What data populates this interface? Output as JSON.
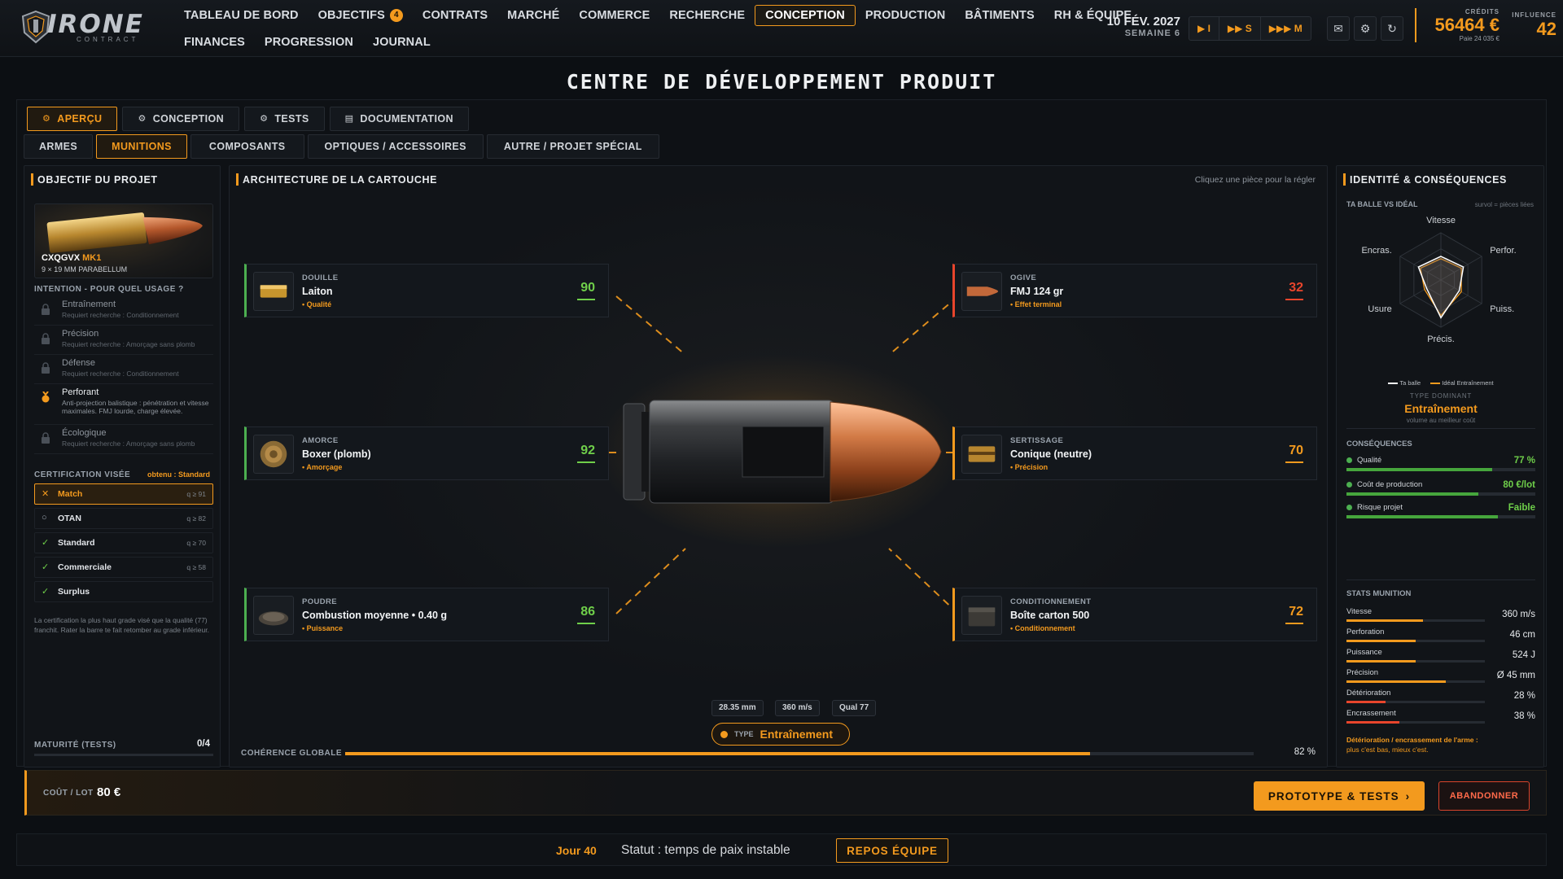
{
  "app": {
    "logo_text": "IRONE",
    "logo_sub": "CONTRACT"
  },
  "nav": {
    "row1": [
      "TABLEAU DE BORD",
      "OBJECTIFS",
      "CONTRATS",
      "MARCHÉ",
      "COMMERCE",
      "RECHERCHE",
      "CONCEPTION",
      "PRODUCTION",
      "BÂTIMENTS",
      "RH & ÉQUIPE"
    ],
    "row2": [
      "FINANCES",
      "PROGRESSION",
      "JOURNAL"
    ],
    "objectifs_badge": "4",
    "active": "CONCEPTION"
  },
  "header": {
    "date": "10 FÉV. 2027",
    "week": "SEMAINE 6",
    "speeds": [
      "▶ I",
      "▶▶ S",
      "▶▶▶ M"
    ],
    "credits_label": "CRÉDITS",
    "credits_value": "56464 €",
    "credits_sub": "Paie 24 035 €",
    "influence_label": "INFLUENCE",
    "influence_value": "42"
  },
  "page": {
    "title": "CENTRE DE DÉVELOPPEMENT PRODUIT",
    "main_tabs": [
      {
        "label": "APERÇU",
        "icon": "gear-icon"
      },
      {
        "label": "CONCEPTION",
        "icon": "gear-icon"
      },
      {
        "label": "TESTS",
        "icon": "gear-icon"
      },
      {
        "label": "DOCUMENTATION",
        "icon": "doc-icon"
      }
    ],
    "category_tabs": [
      "ARMES",
      "MUNITIONS",
      "COMPOSANTS",
      "OPTIQUES / ACCESSOIRES",
      "AUTRE / PROJET SPÉCIAL"
    ]
  },
  "left": {
    "title": "OBJECTIF DU PROJET",
    "product_name": "CXQGVX",
    "product_mk": "MK1",
    "product_caliber": "9 × 19 MM PARABELLUM",
    "intent_label": "INTENTION - POUR QUEL USAGE ?",
    "intents": [
      {
        "name": "Entraînement",
        "req": "Requiert recherche : Conditionnement"
      },
      {
        "name": "Précision",
        "req": "Requiert recherche : Amorçage sans plomb"
      },
      {
        "name": "Défense",
        "req": "Requiert recherche : Conditionnement"
      },
      {
        "name": "Perforant",
        "req": "Anti-projection balistique : pénétration et vitesse maximales. FMJ lourde, charge élevée."
      },
      {
        "name": "Écologique",
        "req": "Requiert recherche : Amorçage sans plomb"
      }
    ],
    "cert_label": "CERTIFICATION VISÉE",
    "cert_obtained": "obtenu : Standard",
    "certs": [
      {
        "name": "Match",
        "q": "q ≥ 91",
        "mark": "✕"
      },
      {
        "name": "OTAN",
        "q": "q ≥ 82",
        "mark": "○"
      },
      {
        "name": "Standard",
        "q": "q ≥ 70",
        "mark": "✓"
      },
      {
        "name": "Commerciale",
        "q": "q ≥ 58",
        "mark": "✓"
      },
      {
        "name": "Surplus",
        "q": "",
        "mark": "✓"
      }
    ],
    "cert_note": "La certification la plus haut grade visé que la qualité (77) franchit. Rater la barre te fait retomber au grade inférieur.",
    "maturity_label": "MATURITÉ (TESTS)",
    "maturity_value": "0/4"
  },
  "center": {
    "title": "ARCHITECTURE DE LA CARTOUCHE",
    "hint": "Cliquez une pièce pour la régler",
    "nodes": [
      {
        "cat": "DOUILLE",
        "value": "Laiton",
        "tag": "• Qualité",
        "score": "90",
        "color": "#6fcf4a"
      },
      {
        "cat": "OGIVE",
        "value": "FMJ 124 gr",
        "tag": "• Effet terminal",
        "score": "32",
        "color": "#e8452c"
      },
      {
        "cat": "AMORCE",
        "value": "Boxer (plomb)",
        "tag": "• Amorçage",
        "score": "92",
        "color": "#6fcf4a"
      },
      {
        "cat": "SERTISSAGE",
        "value": "Conique (neutre)",
        "tag": "• Précision",
        "score": "70",
        "color": "#f39a1e"
      },
      {
        "cat": "POUDRE",
        "value": "Combustion moyenne • 0.40 g",
        "tag": "• Puissance",
        "score": "86",
        "color": "#6fcf4a"
      },
      {
        "cat": "CONDITIONNEMENT",
        "value": "Boîte carton 500",
        "tag": "• Conditionnement",
        "score": "72",
        "color": "#f39a1e"
      }
    ],
    "chips": [
      "28.35 mm",
      "360 m/s",
      "Qual 77"
    ],
    "type_label": "TYPE",
    "type_value": "Entraînement",
    "coherence_label": "COHÉRENCE GLOBALE",
    "coherence_value": "82 %",
    "coherence_fraction": 0.82
  },
  "right": {
    "title": "IDENTITÉ & CONSÉQUENCES",
    "radar_label": "TA BALLE VS IDÉAL",
    "radar_hint": "survol = pièces liées",
    "radar_axes": [
      "Vitesse",
      "Perfor.",
      "Puiss.",
      "Précis.",
      "Usure",
      "Encras."
    ],
    "radar_ball": [
      0.5,
      0.55,
      0.45,
      0.8,
      0.35,
      0.55
    ],
    "radar_ideal": [
      0.45,
      0.5,
      0.5,
      0.75,
      0.4,
      0.5
    ],
    "legend_ball": "Ta balle",
    "legend_ideal": "Idéal Entraînement",
    "dominant_label": "TYPE DOMINANT",
    "dominant_value": "Entraînement",
    "dominant_sub": "volume au meilleur coût",
    "cons_label": "CONSÉQUENCES",
    "consequences": [
      {
        "name": "Qualité",
        "value": "77 %",
        "fraction": 0.77
      },
      {
        "name": "Coût de production",
        "value": "80 €/lot",
        "fraction": 0.7
      },
      {
        "name": "Risque projet",
        "value": "Faible",
        "fraction": 0.8
      }
    ],
    "stats_label": "STATS MUNITION",
    "stats": [
      {
        "name": "Vitesse",
        "value": "360 m/s",
        "fraction": 0.55,
        "color": "#f39a1e"
      },
      {
        "name": "Perforation",
        "value": "46 cm",
        "fraction": 0.5,
        "color": "#f39a1e"
      },
      {
        "name": "Puissance",
        "value": "524 J",
        "fraction": 0.5,
        "color": "#f39a1e"
      },
      {
        "name": "Précision",
        "value": "Ø 45 mm",
        "fraction": 0.72,
        "color": "#f39a1e"
      },
      {
        "name": "Détérioration",
        "value": "28 %",
        "fraction": 0.28,
        "color": "#e8452c"
      },
      {
        "name": "Encrassement",
        "value": "38 %",
        "fraction": 0.38,
        "color": "#e8452c"
      }
    ],
    "note_title": "Détérioration / encrassement de l'arme :",
    "note_sub": "plus c'est bas, mieux c'est."
  },
  "footer": {
    "cost_label": "COÛT / LOT",
    "cost_value": "80 €",
    "primary_btn": "PROTOTYPE & TESTS",
    "danger_btn": "ABANDONNER",
    "day": "Jour 40",
    "status": "Statut : temps de paix instable",
    "rest_btn": "REPOS ÉQUIPE"
  }
}
